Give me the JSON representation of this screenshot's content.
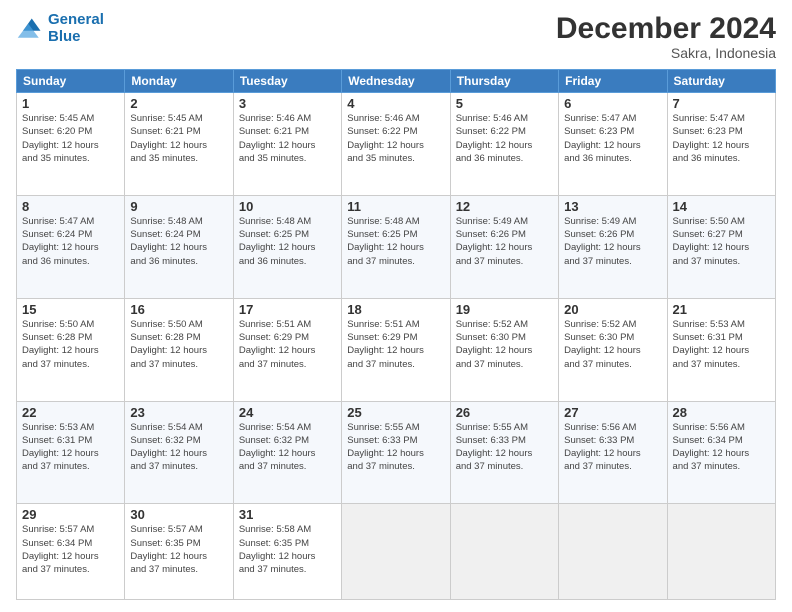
{
  "logo": {
    "line1": "General",
    "line2": "Blue"
  },
  "title": "December 2024",
  "subtitle": "Sakra, Indonesia",
  "header_days": [
    "Sunday",
    "Monday",
    "Tuesday",
    "Wednesday",
    "Thursday",
    "Friday",
    "Saturday"
  ],
  "weeks": [
    [
      {
        "day": "1",
        "info": "Sunrise: 5:45 AM\nSunset: 6:20 PM\nDaylight: 12 hours\nand 35 minutes."
      },
      {
        "day": "2",
        "info": "Sunrise: 5:45 AM\nSunset: 6:21 PM\nDaylight: 12 hours\nand 35 minutes."
      },
      {
        "day": "3",
        "info": "Sunrise: 5:46 AM\nSunset: 6:21 PM\nDaylight: 12 hours\nand 35 minutes."
      },
      {
        "day": "4",
        "info": "Sunrise: 5:46 AM\nSunset: 6:22 PM\nDaylight: 12 hours\nand 35 minutes."
      },
      {
        "day": "5",
        "info": "Sunrise: 5:46 AM\nSunset: 6:22 PM\nDaylight: 12 hours\nand 36 minutes."
      },
      {
        "day": "6",
        "info": "Sunrise: 5:47 AM\nSunset: 6:23 PM\nDaylight: 12 hours\nand 36 minutes."
      },
      {
        "day": "7",
        "info": "Sunrise: 5:47 AM\nSunset: 6:23 PM\nDaylight: 12 hours\nand 36 minutes."
      }
    ],
    [
      {
        "day": "8",
        "info": "Sunrise: 5:47 AM\nSunset: 6:24 PM\nDaylight: 12 hours\nand 36 minutes."
      },
      {
        "day": "9",
        "info": "Sunrise: 5:48 AM\nSunset: 6:24 PM\nDaylight: 12 hours\nand 36 minutes."
      },
      {
        "day": "10",
        "info": "Sunrise: 5:48 AM\nSunset: 6:25 PM\nDaylight: 12 hours\nand 36 minutes."
      },
      {
        "day": "11",
        "info": "Sunrise: 5:48 AM\nSunset: 6:25 PM\nDaylight: 12 hours\nand 37 minutes."
      },
      {
        "day": "12",
        "info": "Sunrise: 5:49 AM\nSunset: 6:26 PM\nDaylight: 12 hours\nand 37 minutes."
      },
      {
        "day": "13",
        "info": "Sunrise: 5:49 AM\nSunset: 6:26 PM\nDaylight: 12 hours\nand 37 minutes."
      },
      {
        "day": "14",
        "info": "Sunrise: 5:50 AM\nSunset: 6:27 PM\nDaylight: 12 hours\nand 37 minutes."
      }
    ],
    [
      {
        "day": "15",
        "info": "Sunrise: 5:50 AM\nSunset: 6:28 PM\nDaylight: 12 hours\nand 37 minutes."
      },
      {
        "day": "16",
        "info": "Sunrise: 5:50 AM\nSunset: 6:28 PM\nDaylight: 12 hours\nand 37 minutes."
      },
      {
        "day": "17",
        "info": "Sunrise: 5:51 AM\nSunset: 6:29 PM\nDaylight: 12 hours\nand 37 minutes."
      },
      {
        "day": "18",
        "info": "Sunrise: 5:51 AM\nSunset: 6:29 PM\nDaylight: 12 hours\nand 37 minutes."
      },
      {
        "day": "19",
        "info": "Sunrise: 5:52 AM\nSunset: 6:30 PM\nDaylight: 12 hours\nand 37 minutes."
      },
      {
        "day": "20",
        "info": "Sunrise: 5:52 AM\nSunset: 6:30 PM\nDaylight: 12 hours\nand 37 minutes."
      },
      {
        "day": "21",
        "info": "Sunrise: 5:53 AM\nSunset: 6:31 PM\nDaylight: 12 hours\nand 37 minutes."
      }
    ],
    [
      {
        "day": "22",
        "info": "Sunrise: 5:53 AM\nSunset: 6:31 PM\nDaylight: 12 hours\nand 37 minutes."
      },
      {
        "day": "23",
        "info": "Sunrise: 5:54 AM\nSunset: 6:32 PM\nDaylight: 12 hours\nand 37 minutes."
      },
      {
        "day": "24",
        "info": "Sunrise: 5:54 AM\nSunset: 6:32 PM\nDaylight: 12 hours\nand 37 minutes."
      },
      {
        "day": "25",
        "info": "Sunrise: 5:55 AM\nSunset: 6:33 PM\nDaylight: 12 hours\nand 37 minutes."
      },
      {
        "day": "26",
        "info": "Sunrise: 5:55 AM\nSunset: 6:33 PM\nDaylight: 12 hours\nand 37 minutes."
      },
      {
        "day": "27",
        "info": "Sunrise: 5:56 AM\nSunset: 6:33 PM\nDaylight: 12 hours\nand 37 minutes."
      },
      {
        "day": "28",
        "info": "Sunrise: 5:56 AM\nSunset: 6:34 PM\nDaylight: 12 hours\nand 37 minutes."
      }
    ],
    [
      {
        "day": "29",
        "info": "Sunrise: 5:57 AM\nSunset: 6:34 PM\nDaylight: 12 hours\nand 37 minutes."
      },
      {
        "day": "30",
        "info": "Sunrise: 5:57 AM\nSunset: 6:35 PM\nDaylight: 12 hours\nand 37 minutes."
      },
      {
        "day": "31",
        "info": "Sunrise: 5:58 AM\nSunset: 6:35 PM\nDaylight: 12 hours\nand 37 minutes."
      },
      {
        "day": "",
        "info": ""
      },
      {
        "day": "",
        "info": ""
      },
      {
        "day": "",
        "info": ""
      },
      {
        "day": "",
        "info": ""
      }
    ]
  ]
}
